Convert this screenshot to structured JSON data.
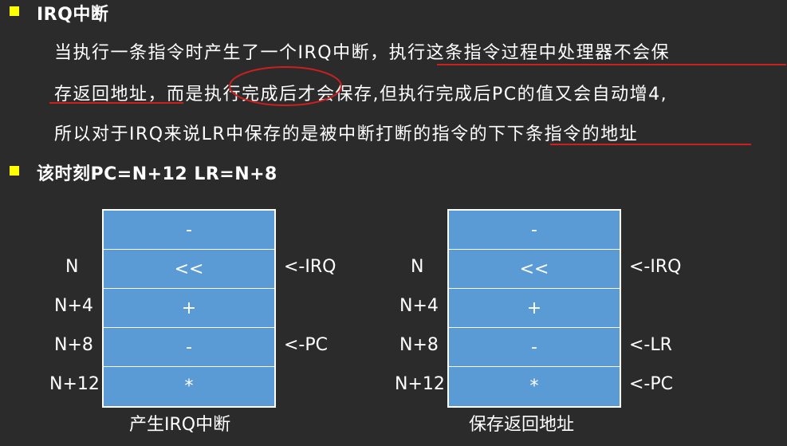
{
  "heading1": "IRQ中断",
  "paragraph": {
    "line1": "当执行一条指令时产生了一个IRQ中断，执行这条指令过程中处理器不会保",
    "line2": "存返回地址，而是执行完成后才会保存,但执行完成后PC的值又会自动增4,",
    "line3": "所以对于IRQ来说LR中保存的是被中断打断的指令的下下条指令的地址"
  },
  "heading2": "该时刻PC=N+12 LR=N+8",
  "diagram_left": {
    "caption": "产生IRQ中断",
    "cells": [
      "-",
      "<<",
      "+",
      "-",
      "*"
    ],
    "row_labels": [
      "N",
      "N+4",
      "N+8",
      "N+12"
    ],
    "pointers": [
      "<-IRQ",
      "<-PC"
    ]
  },
  "diagram_right": {
    "caption": "保存返回地址",
    "cells": [
      "-",
      "<<",
      "+",
      "-",
      "*"
    ],
    "row_labels": [
      "N",
      "N+4",
      "N+8",
      "N+12"
    ],
    "pointers": [
      "<-IRQ",
      "<-LR",
      "<-PC"
    ]
  },
  "colors": {
    "background": "#2b2b2b",
    "bullet": "#ffff00",
    "cell_fill": "#5b9bd5",
    "annotation": "#cc1f1f"
  }
}
